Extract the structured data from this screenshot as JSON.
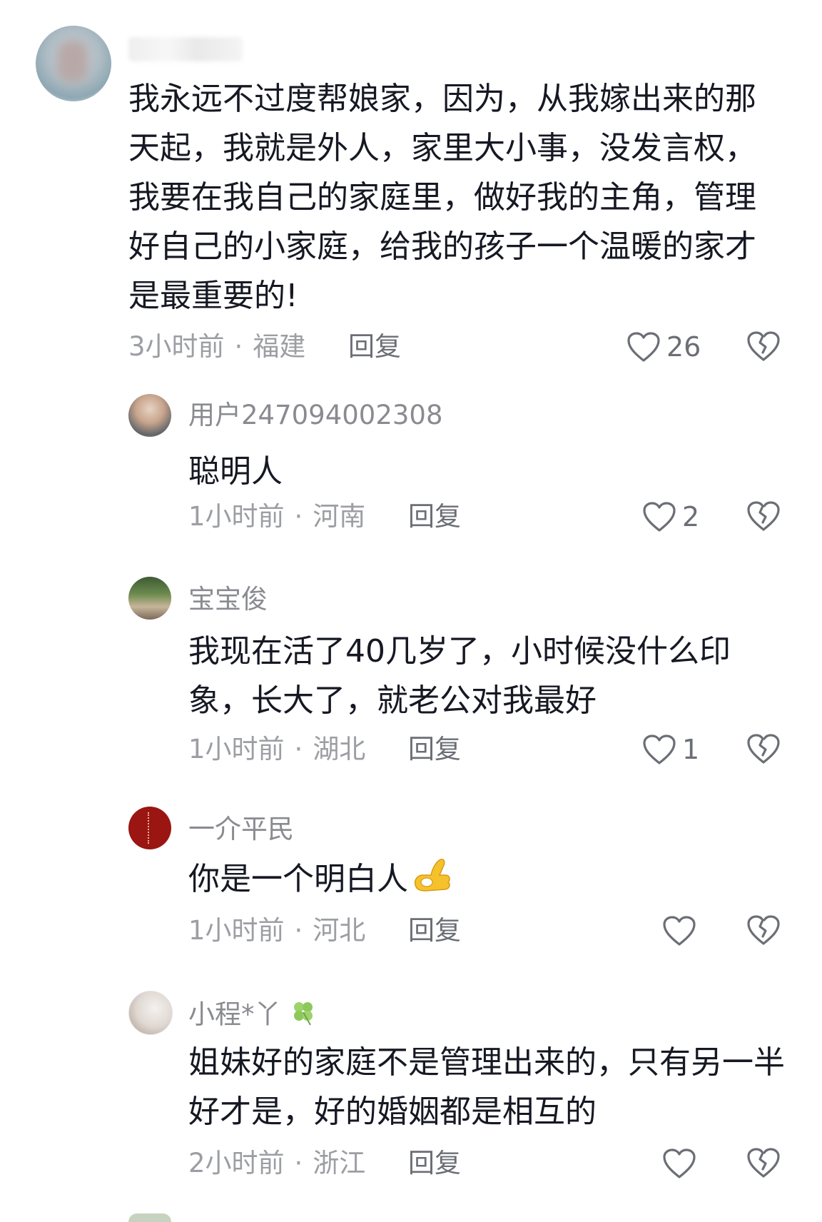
{
  "comments": [
    {
      "username": "",
      "text": "我永远不过度帮娘家，因为，从我嫁出来的那天起，我就是外人，家里大小事，没发言权，我要在我自己的家庭里，做好我的主角，管理好自己的小家庭，给我的孩子一个温暖的家才是最重要的!",
      "time": "3小时前",
      "location": "福建",
      "reply_label": "回复",
      "likes": "26"
    }
  ],
  "replies": [
    {
      "username": "用户247094002308",
      "text": "聪明人",
      "time": "1小时前",
      "location": "河南",
      "reply_label": "回复",
      "likes": "2"
    },
    {
      "username": "宝宝俊",
      "text": "我现在活了40几岁了，小时候没什么印象，长大了，就老公对我最好",
      "time": "1小时前",
      "location": "湖北",
      "reply_label": "回复",
      "likes": "1"
    },
    {
      "username": "一介平民",
      "text": "你是一个明白人",
      "emoji": "ok-hand-emoji",
      "time": "1小时前",
      "location": "河北",
      "reply_label": "回复",
      "likes": ""
    },
    {
      "username": "小程*丫",
      "username_emoji": "four-leaf-clover-emoji",
      "text": "姐妹好的家庭不是管理出来的，只有另一半好才是，好的婚姻都是相互的",
      "time": "2小时前",
      "location": "浙江",
      "reply_label": "回复",
      "likes": ""
    }
  ],
  "dot": "·",
  "icons": {
    "like": "heart-outline-icon",
    "dislike": "broken-heart-outline-icon"
  },
  "colors": {
    "text": "#161823",
    "meta": "#9c9ea3",
    "icon": "#6b6e75"
  }
}
